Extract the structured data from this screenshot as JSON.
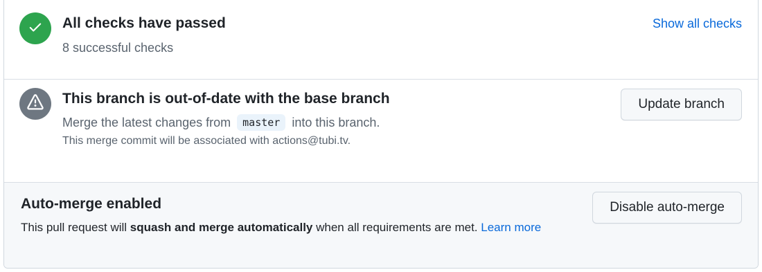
{
  "colors": {
    "success": "#2da44e",
    "neutral": "#6e7781",
    "link": "#0969da",
    "text": "#1f2328",
    "muted": "#59636e",
    "border": "#d0d7de",
    "auto_merge_bg": "#f6f8fa"
  },
  "checks": {
    "icon": "check-icon",
    "title": "All checks have passed",
    "subtitle": "8 successful checks",
    "show_all_label": "Show all checks"
  },
  "branch": {
    "icon": "alert-icon",
    "title": "This branch is out-of-date with the base branch",
    "line_prefix": "Merge the latest changes from",
    "base_branch": "master",
    "line_suffix": "into this branch.",
    "commit_note": "This merge commit will be associated with actions@tubi.tv.",
    "update_button_label": "Update branch"
  },
  "auto_merge": {
    "title": "Auto-merge enabled",
    "desc_prefix": "This pull request will",
    "desc_strong": "squash and merge automatically",
    "desc_suffix": "when all requirements are met.",
    "learn_more_label": "Learn more",
    "disable_button_label": "Disable auto-merge"
  }
}
